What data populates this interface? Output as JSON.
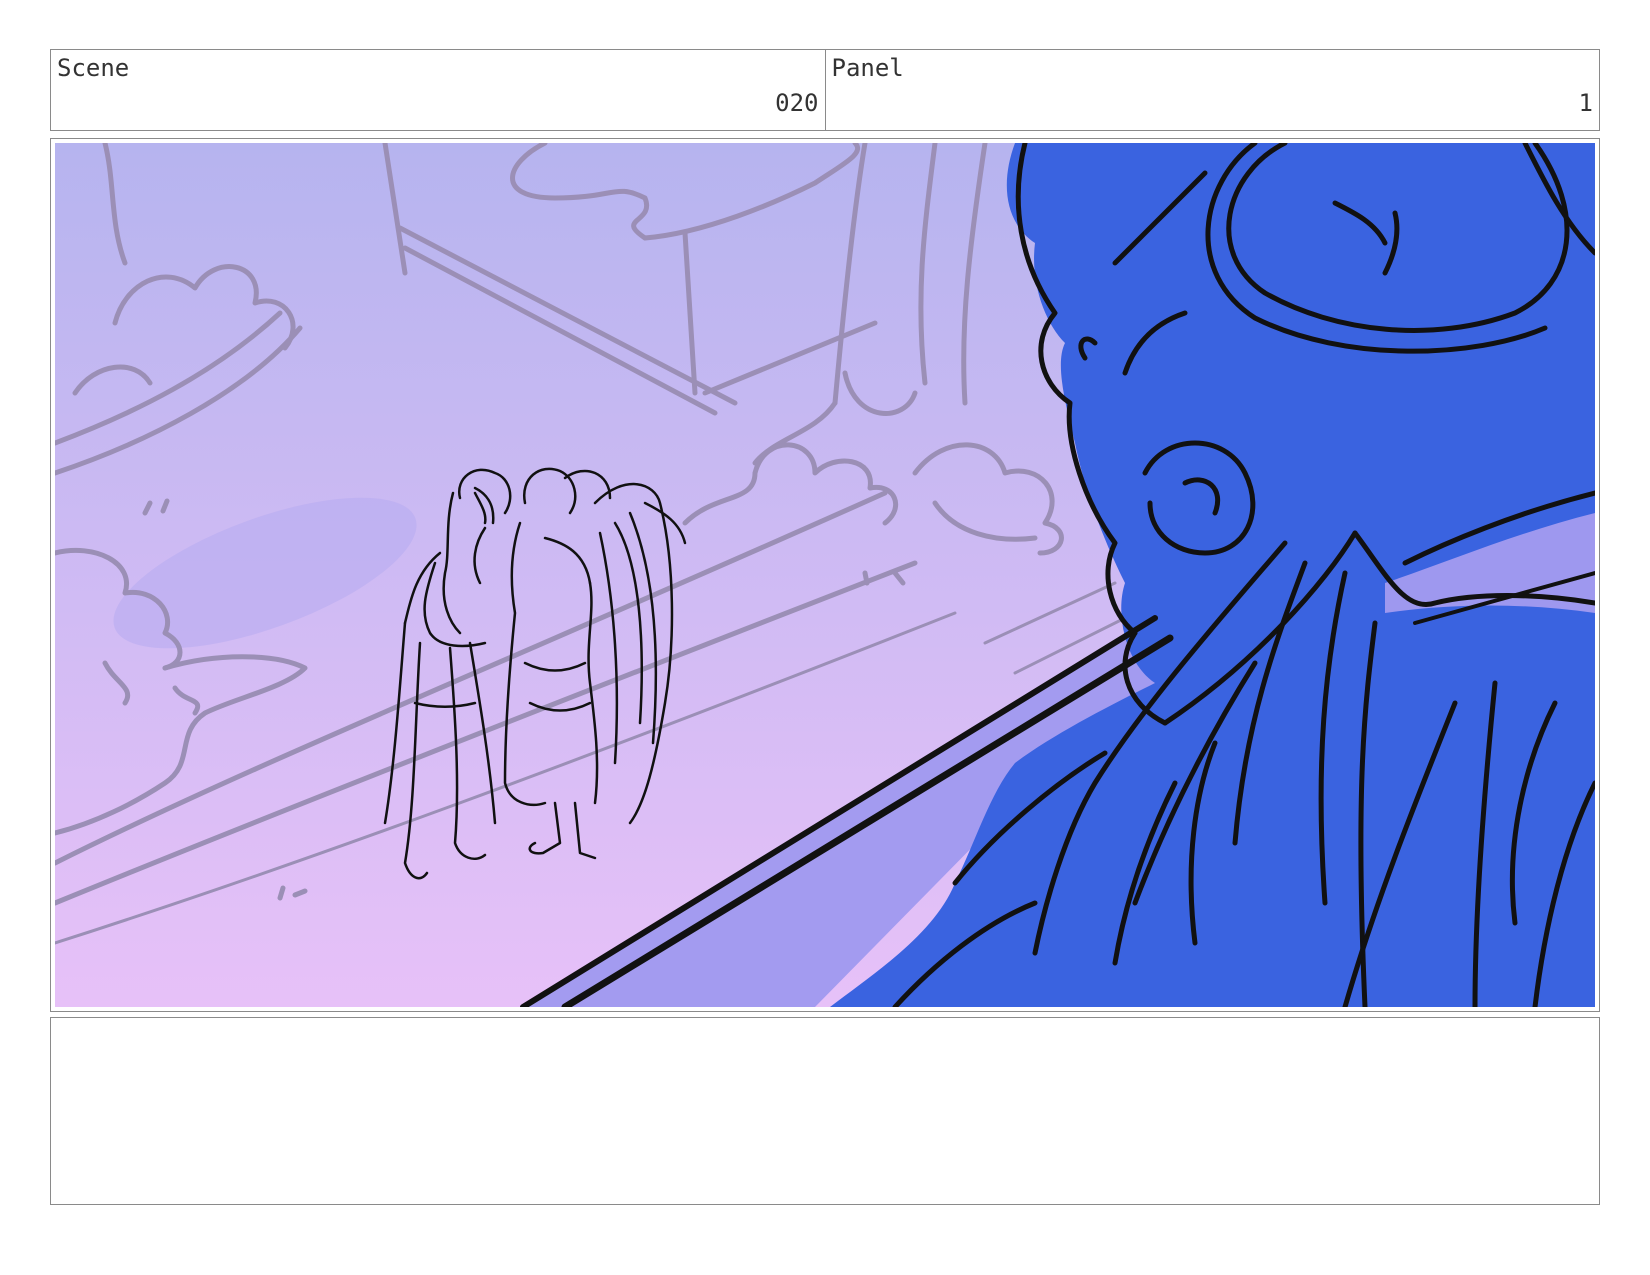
{
  "header": {
    "scene_label": "Scene",
    "scene_number": "020",
    "panel_label": "Panel",
    "panel_number": "1"
  },
  "panel": {
    "sky_top_color": "#b6b4ef",
    "sky_bottom_color": "#e7c1f8",
    "foreground_fill_color": "#3a63e0",
    "ledge_shadow_color": "#a39bf0",
    "sketch_line_color": "#9b8fb6",
    "ink_color": "#111111"
  },
  "notes": {
    "text": ""
  }
}
